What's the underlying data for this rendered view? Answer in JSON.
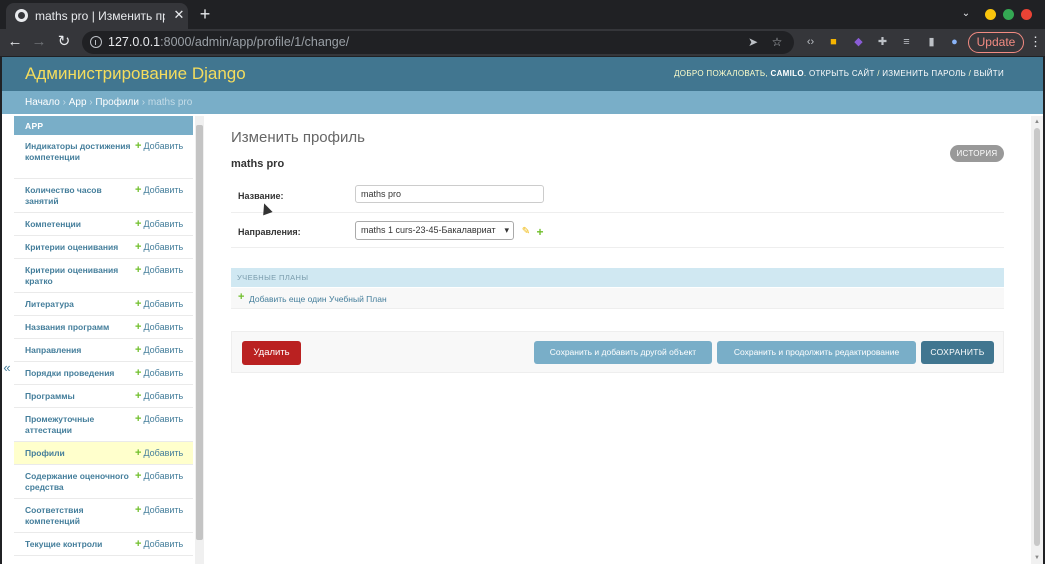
{
  "browser": {
    "tab_title": "maths pro | Изменить профи",
    "tab_close": "✕",
    "newtab": "+",
    "tab_search": "⌄",
    "url_host": "127.0.0.1",
    "url_path": ":8000/admin/app/profile/1/change/",
    "update_label": "Update",
    "kebab": "⋮",
    "colors": {
      "dot_yellow": "#f9c50d",
      "dot_green": "#34a853",
      "dot_red": "#ea4335",
      "update": "#f28b82"
    }
  },
  "header": {
    "branding": "Администрирование Django",
    "welcome": "ДОБРО ПОЖАЛОВАТЬ,",
    "username": "CAMILO",
    "view_site": "ОТКРЫТЬ САЙТ",
    "change_password": "ИЗМЕНИТЬ ПАРОЛЬ",
    "logout": "ВЫЙТИ",
    "separator": " / "
  },
  "breadcrumbs": {
    "home": "Начало",
    "app": "App",
    "model": "Профили",
    "current": "maths pro",
    "sep": " › "
  },
  "sidebar": {
    "caption": "APP",
    "add_label": "Добавить",
    "collapse": "«",
    "items": [
      {
        "label": "Индикаторы достижения компетенции"
      },
      {
        "label": "Количество часов занятий"
      },
      {
        "label": "Компетенции"
      },
      {
        "label": "Критерии оценивания"
      },
      {
        "label": "Критерии оценивания кратко"
      },
      {
        "label": "Литература"
      },
      {
        "label": "Названия программ"
      },
      {
        "label": "Направления"
      },
      {
        "label": "Порядки проведения"
      },
      {
        "label": "Программы"
      },
      {
        "label": "Промежуточные аттестации"
      },
      {
        "label": "Профили"
      },
      {
        "label": "Содержание оценочного средства"
      },
      {
        "label": "Соответствия компетенций"
      },
      {
        "label": "Текущие контроли"
      }
    ]
  },
  "content": {
    "page_title": "Изменить профиль",
    "object_title": "maths pro",
    "history_label": "ИСТОРИЯ",
    "fields": {
      "name_label": "Название:",
      "name_value": "maths pro",
      "direction_label": "Направления:",
      "direction_value": "maths 1 curs-23-45-Бакалавриат"
    },
    "inline": {
      "caption": "УЧЕБНЫЕ ПЛАНЫ",
      "add_label": "Добавить еще один Учебный План"
    },
    "submit": {
      "delete_label": "Удалить",
      "save_add_label": "Сохранить и добавить другой объект",
      "save_continue_label": "Сохранить и продолжить редактирование",
      "save_label": "СОХРАНИТЬ"
    }
  }
}
